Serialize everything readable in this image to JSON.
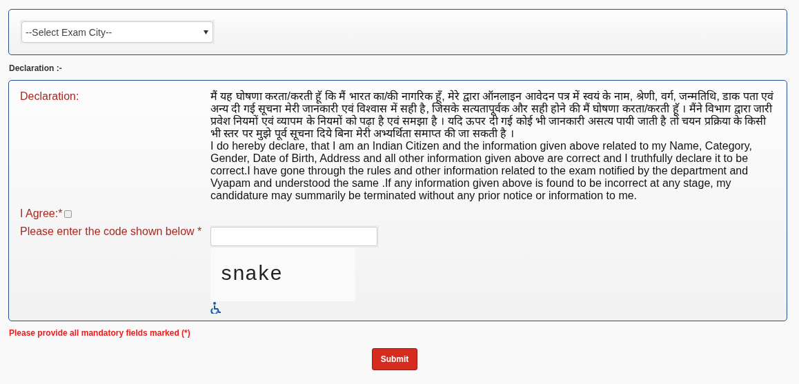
{
  "city_select": {
    "placeholder": "--Select Exam City--"
  },
  "section_heading": "Declaration :-",
  "declaration": {
    "label": "Declaration:",
    "paragraphs": [
      "मैं यह घोषणा करता/करती हूॅ कि मैं भारत का/की नागरिक हूँ, मेरे द्वारा ऑनलाइन आवेदन पत्र में स्वयं के नाम, श्रेणी, वर्ग, जन्मतिथि, डाक पता एवं अन्य दी गई सूचना मेरी जानकारी एवं विश्वास में सही है, जिसके सत्यतापूर्वक और सही होने की मैं घोषणा करता/करती हूॅ । मैंने विभाग द्वारा जारी प्रवेश नियमों एवं व्यापम के नियमों को पढ़ा है एवं समझा है । यदि ऊपर दी गई कोई भी जानकारी असत्य पायी जाती है तो चयन प्रक्रिया के किसी भी स्तर पर मुझे पूर्व सूचना दिये बिना मेरी अभ्यर्थिता समाप्त की जा सकती है ।",
      "I do hereby declare, that I am an Indian Citizen and the information given above related to my Name, Category, Gender, Date of Birth, Address and all other information given above are correct and I truthfully declare it to be correct.I have gone through the rules and other information related to the exam notified by the department and Vyapam and understood the same .If any information given above is found to be incorrect at any stage, my candidature may summarily be terminated without any prior notice or information to me."
    ]
  },
  "agree": {
    "label": "I Agree:*",
    "checked": false
  },
  "captcha": {
    "label": "Please enter the code shown below *",
    "code": "snake"
  },
  "error_message": "Please provide all mandatory fields marked (*)",
  "submit_button": "Submit"
}
